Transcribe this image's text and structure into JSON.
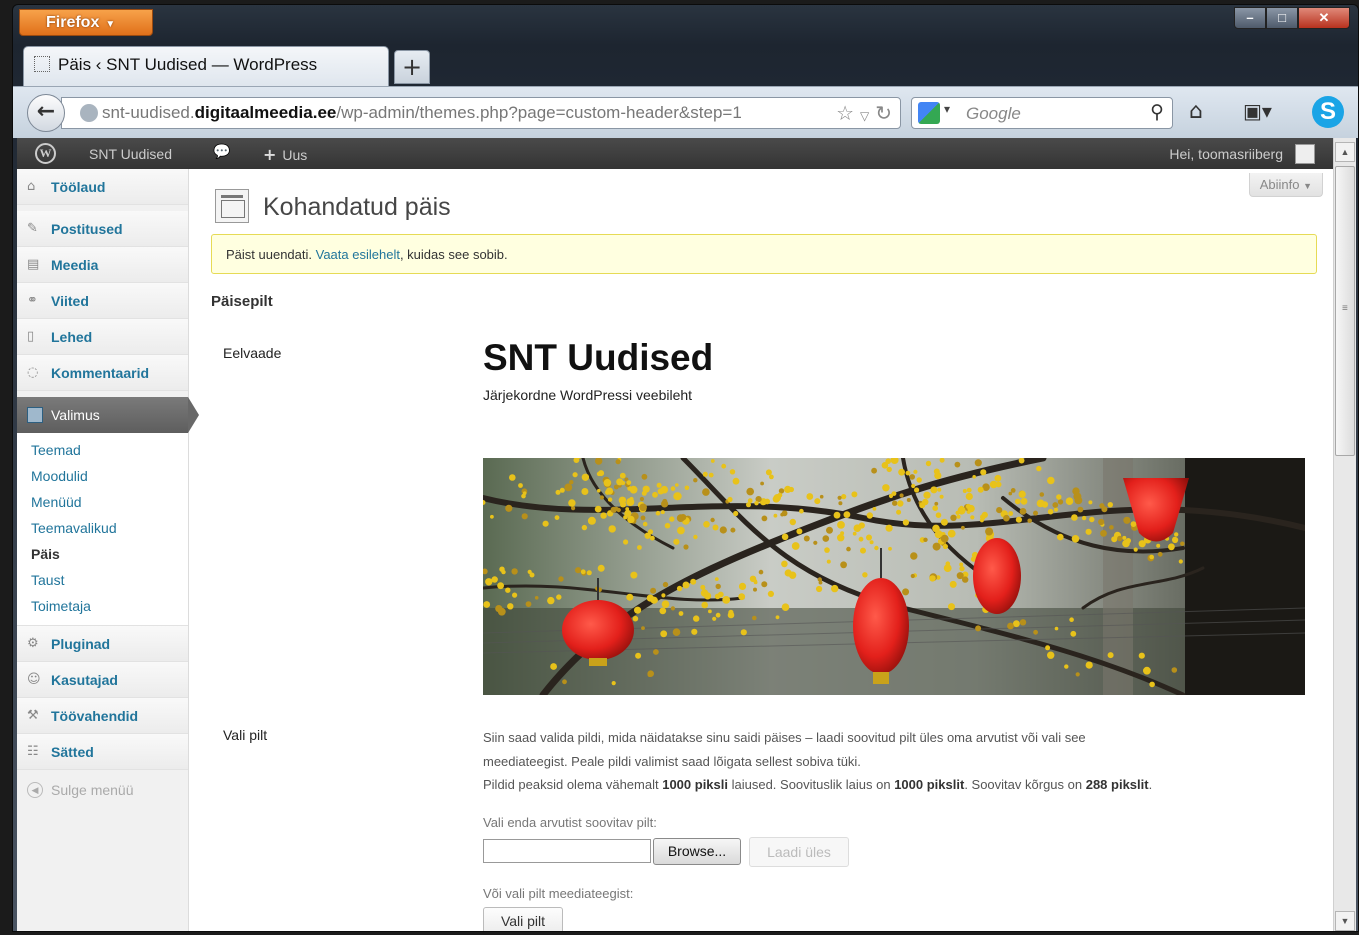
{
  "browser": {
    "menu_button": "Firefox",
    "tab_title": "Päis ‹ SNT Uudised — WordPress",
    "new_tab": "+",
    "url_prefix": "snt-uudised.",
    "url_domain": "digitaalmeedia.ee",
    "url_path": "/wp-admin/themes.php?page=custom-header&step=1",
    "search_placeholder": "Google"
  },
  "adminbar": {
    "site_name": "SNT Uudised",
    "new_label": "Uus",
    "howdy": "Hei, toomasriiberg"
  },
  "sidebar": {
    "top_items": [
      {
        "label": "Töölaud",
        "icon": "dashboard-icon"
      },
      {
        "label": "Postitused",
        "icon": "pin-icon"
      },
      {
        "label": "Meedia",
        "icon": "media-icon"
      },
      {
        "label": "Viited",
        "icon": "link-icon"
      },
      {
        "label": "Lehed",
        "icon": "pages-icon"
      },
      {
        "label": "Kommentaarid",
        "icon": "comments-icon"
      }
    ],
    "active_item": "Valimus",
    "submenu": [
      "Teemad",
      "Moodulid",
      "Menüüd",
      "Teemavalikud",
      "Päis",
      "Taust",
      "Toimetaja"
    ],
    "current_submenu": "Päis",
    "bottom_items": [
      {
        "label": "Pluginad",
        "icon": "plugins-icon"
      },
      {
        "label": "Kasutajad",
        "icon": "users-icon"
      },
      {
        "label": "Töövahendid",
        "icon": "tools-icon"
      },
      {
        "label": "Sätted",
        "icon": "settings-icon"
      }
    ],
    "collapse": "Sulge menüü"
  },
  "content": {
    "help_button": "Abiinfo",
    "page_title": "Kohandatud päis",
    "notice_before": "Päist uuendati. ",
    "notice_link": "Vaata esilehelt",
    "notice_after": ", kuidas see sobib.",
    "section_title": "Päisepilt",
    "preview_label": "Eelvaade",
    "preview_site_title": "SNT Uudised",
    "preview_tagline": "Järjekordne WordPressi veebileht",
    "choose_label": "Vali pilt",
    "desc_line1": "Siin saad valida pildi, mida näidatakse sinu saidi päises – laadi soovitud pilt üles oma arvutist või vali see",
    "desc_line2": "meediateegist. Peale pildi valimist saad lõigata sellest sobiva tüki.",
    "desc_line3_a": "Pildid peaksid olema vähemalt ",
    "desc_line3_b": "1000 piksli",
    "desc_line3_c": " laiused. Soovituslik laius on ",
    "desc_line3_d": "1000 pikslit",
    "desc_line3_e": ". Soovitav kõrgus on ",
    "desc_line3_f": "288 pikslit",
    "desc_line3_g": ".",
    "upload_label": "Vali enda arvutist soovitav pilt:",
    "browse_button": "Browse...",
    "upload_button": "Laadi üles",
    "library_label": "Või vali pilt meediateegist:",
    "choose_button": "Vali pilt"
  },
  "colors": {
    "wp_link": "#21759b",
    "notice_bg": "#ffffe0",
    "notice_border": "#e6db55",
    "active_menu": "#6a6a6a",
    "lantern_red": "#e3201b",
    "blossom_yellow": "#e8c21a"
  }
}
